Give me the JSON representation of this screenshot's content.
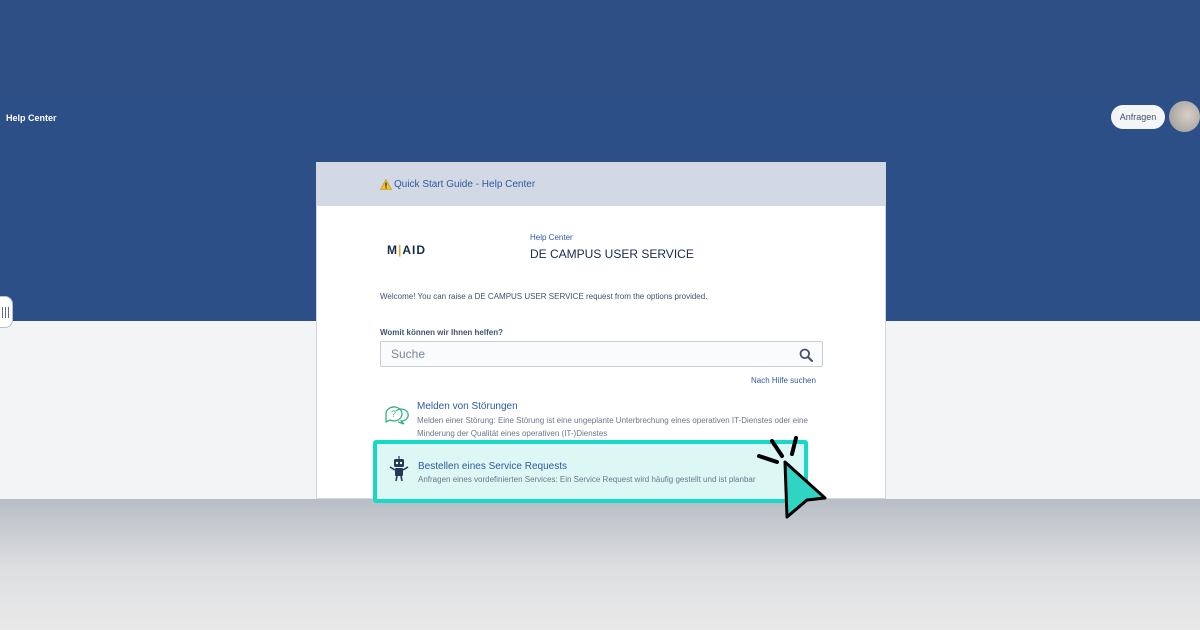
{
  "topbar": {
    "help_center_label": "Help Center",
    "requests_label": "Anfragen"
  },
  "banner": {
    "link_label": "Quick Start Guide - Help Center"
  },
  "portal": {
    "logo_left": "M",
    "logo_bar": "|",
    "logo_right": "AID",
    "breadcrumb": "Help Center",
    "title": "DE CAMPUS USER SERVICE",
    "welcome": "Welcome! You can raise a DE CAMPUS USER SERVICE request from the options provided."
  },
  "search": {
    "label": "Womit können wir Ihnen helfen?",
    "placeholder": "Suche",
    "help_link": "Nach Hilfe suchen"
  },
  "request_types": [
    {
      "title": "Melden von Störungen",
      "description": "Melden einer Störung: Eine Störung ist eine ungeplante Unterbrechung eines operativen IT-Dienstes oder eine Minderung der Qualität eines operativen (IT-)Dienstes",
      "icon": "question-chat-icon"
    },
    {
      "title": "Bestellen eines Service Requests",
      "description": "Anfragen eines vordefinierten Services: Ein Service Request wird häufig gestellt und ist planbar",
      "icon": "robot-icon"
    }
  ],
  "colors": {
    "header_blue": "#2b4f86",
    "link_blue": "#2d5a9f",
    "highlight_border": "#19d8c5",
    "highlight_fill": "#ddf7f5",
    "cursor_fill": "#2fd4c2"
  }
}
